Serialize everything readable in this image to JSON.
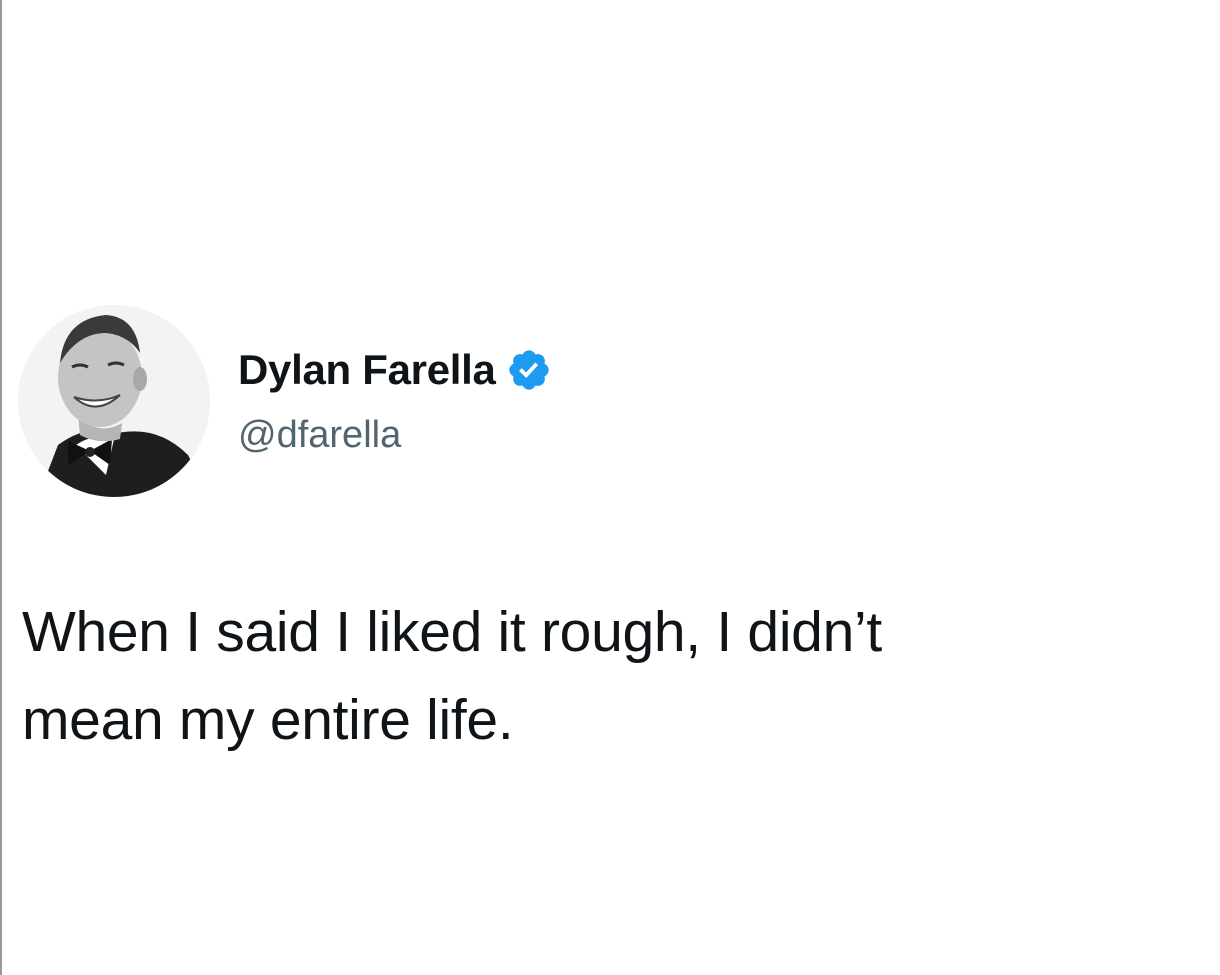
{
  "tweet": {
    "author": {
      "display_name": "Dylan Farella",
      "handle": "@dfarella",
      "verified": true,
      "verified_color": "#1d9bf0",
      "avatar_icon": "profile-photo"
    },
    "text_lines": [
      "When I said I liked it rough, I didn’t",
      "mean my entire life."
    ]
  }
}
